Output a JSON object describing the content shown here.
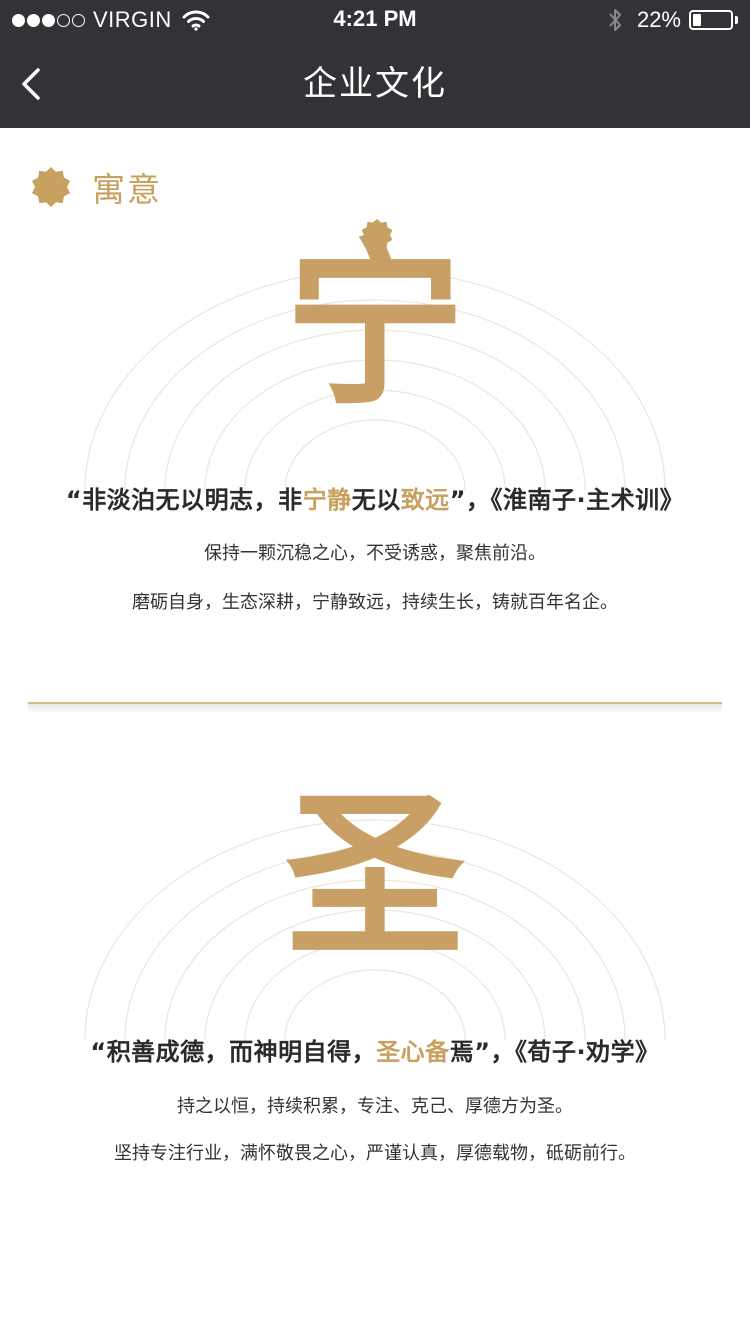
{
  "status_bar": {
    "carrier": "VIRGIN",
    "time": "4:21 PM",
    "battery": "22%",
    "battery_level": 0.22,
    "signal_bars_filled": 3,
    "signal_bars_total": 5
  },
  "nav": {
    "title": "企业文化",
    "back_icon": "chevron-left-icon"
  },
  "section": {
    "title": "寓意",
    "icon": "badge-star-icon"
  },
  "colors": {
    "accent": "#c8a05f",
    "nav_bg": "#323336"
  },
  "cards": [
    {
      "char": "宁",
      "quote": {
        "open": "“",
        "p1": "非淡泊无以明志，非",
        "h1": "宁静",
        "p2": "无以",
        "h2": "致远",
        "close": "”",
        "source": "，《淮南子·主术训》"
      },
      "lines": [
        "保持一颗沉稳之心，不受诱惑，聚焦前沿。",
        "磨砺自身，生态深耕，宁静致远，持续生长，铸就百年名企。"
      ]
    },
    {
      "char": "圣",
      "quote": {
        "open": "“",
        "p1": "积善成德，而神明自得，",
        "h1": "圣心备",
        "p2": "焉",
        "close": "”",
        "source": "，《荀子·劝学》"
      },
      "lines": [
        "持之以恒，持续积累，专注、克己、厚德方为圣。",
        "坚持专注行业，满怀敬畏之心，严谨认真，厚德载物，砥砺前行。"
      ]
    }
  ]
}
